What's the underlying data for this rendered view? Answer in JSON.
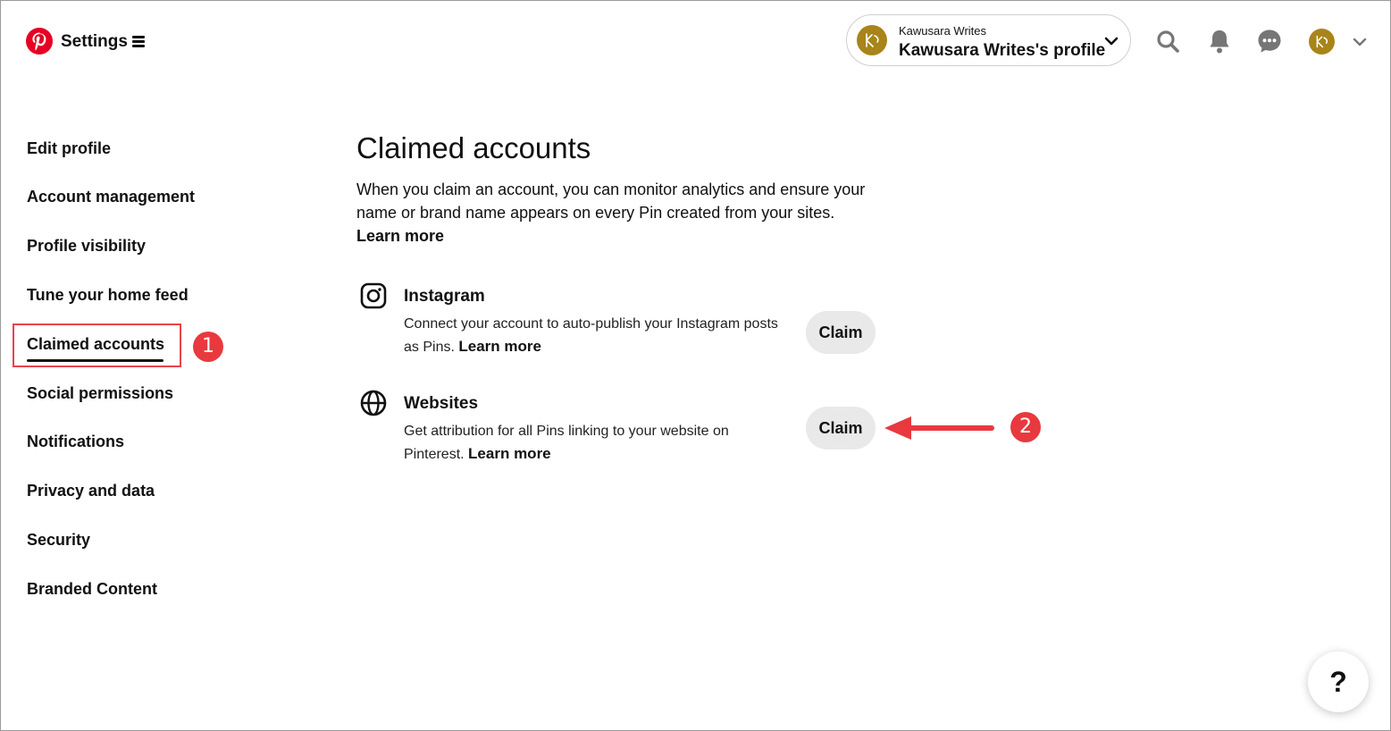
{
  "header": {
    "logo": "pinterest-logo",
    "settings_label": "Settings",
    "profile_switcher": {
      "small_text": "Kawusara Writes",
      "profile_label": "Kawusara Writes's profile"
    },
    "icons": [
      "search-icon",
      "bell-icon",
      "messages-icon",
      "avatar",
      "chevron-down-icon"
    ]
  },
  "sidebar": {
    "items": [
      {
        "label": "Edit profile"
      },
      {
        "label": "Account management"
      },
      {
        "label": "Profile visibility"
      },
      {
        "label": "Tune your home feed"
      },
      {
        "label": "Claimed accounts",
        "active": true
      },
      {
        "label": "Social permissions"
      },
      {
        "label": "Notifications"
      },
      {
        "label": "Privacy and data"
      },
      {
        "label": "Security"
      },
      {
        "label": "Branded Content"
      }
    ]
  },
  "main": {
    "title": "Claimed accounts",
    "intro_text": "When you claim an account, you can monitor analytics and ensure your name or brand name appears on every Pin created from your sites.",
    "intro_link": "Learn more",
    "accounts": [
      {
        "icon": "instagram-icon",
        "title": "Instagram",
        "description": "Connect your account to auto-publish your Instagram posts as Pins.",
        "link": "Learn more",
        "button": "Claim"
      },
      {
        "icon": "globe-icon",
        "title": "Websites",
        "description": "Get attribution for all Pins linking to your website on Pinterest.",
        "link": "Learn more",
        "button": "Claim"
      }
    ]
  },
  "annotations": {
    "badge_1": "1",
    "badge_2": "2"
  },
  "help_button": "?",
  "colors": {
    "brand_red": "#e60023",
    "annotation_red": "#e8393f",
    "button_gray": "#e9e9e9",
    "avatar_gold": "#a8841a"
  }
}
